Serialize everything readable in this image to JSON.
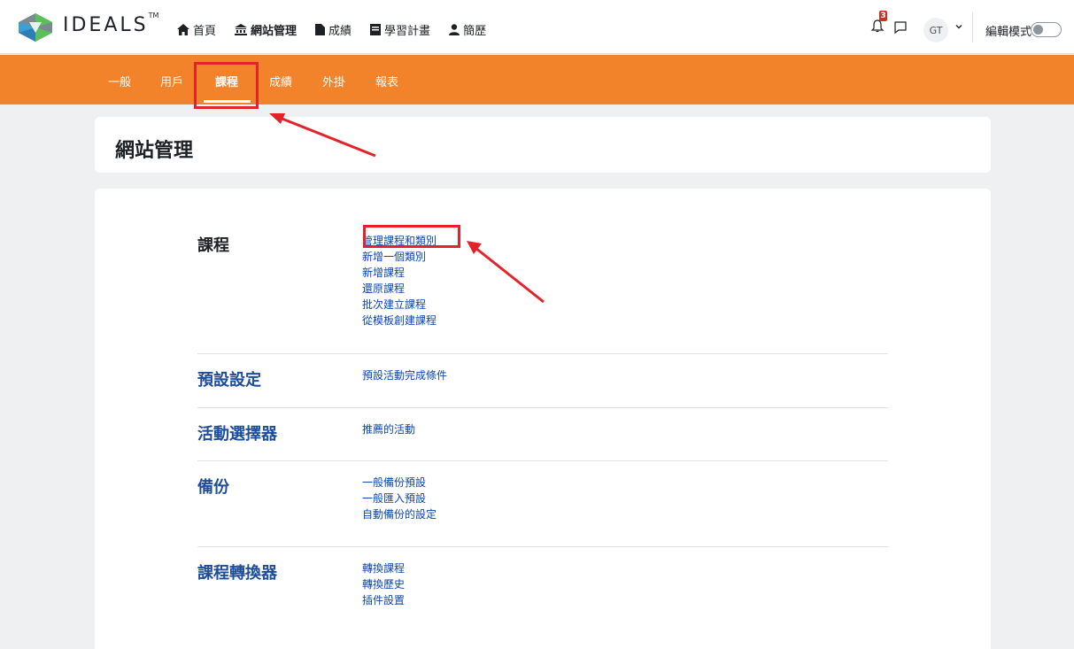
{
  "brand": {
    "name": "IDEALS",
    "trademark": "TM"
  },
  "primary_nav": [
    {
      "label": "首頁",
      "icon": "home-icon"
    },
    {
      "label": "網站管理",
      "icon": "bank-icon",
      "active": true
    },
    {
      "label": "成績",
      "icon": "file-icon"
    },
    {
      "label": "學習計畫",
      "icon": "board-icon"
    },
    {
      "label": "簡歷",
      "icon": "user-icon"
    }
  ],
  "notifications": {
    "count": "3"
  },
  "user": {
    "initials": "GT"
  },
  "edit_mode": {
    "label": "編輯模式",
    "enabled": false
  },
  "secondary_nav": [
    {
      "label": "一般"
    },
    {
      "label": "用戶"
    },
    {
      "label": "課程",
      "active": true
    },
    {
      "label": "成績"
    },
    {
      "label": "外掛"
    },
    {
      "label": "報表"
    }
  ],
  "page": {
    "title": "網站管理"
  },
  "sections": [
    {
      "title": "課程",
      "links": [
        "管理課程和類別",
        "新增一個類別",
        "新增課程",
        "還原課程",
        "批次建立課程",
        "從模板創建課程"
      ]
    },
    {
      "title": "預設設定",
      "links": [
        "預設活動完成條件"
      ]
    },
    {
      "title": "活動選擇器",
      "links": [
        "推薦的活動"
      ]
    },
    {
      "title": "備份",
      "links": [
        "一般備份預設",
        "一般匯入預設",
        "自動備份的設定"
      ]
    },
    {
      "title": "課程轉換器",
      "links": [
        "轉換課程",
        "轉換歷史",
        "插件設置"
      ]
    }
  ],
  "colors": {
    "accent": "#f2832a",
    "link": "#0f47ad",
    "heading_blue": "#1e4d9a",
    "annotation": "#e4222a"
  }
}
